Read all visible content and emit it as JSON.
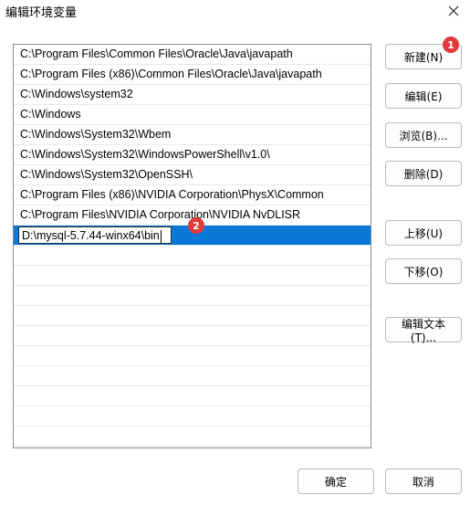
{
  "window": {
    "title": "编辑环境变量"
  },
  "path_entries": [
    "C:\\Program Files\\Common Files\\Oracle\\Java\\javapath",
    "C:\\Program Files (x86)\\Common Files\\Oracle\\Java\\javapath",
    "C:\\Windows\\system32",
    "C:\\Windows",
    "C:\\Windows\\System32\\Wbem",
    "C:\\Windows\\System32\\WindowsPowerShell\\v1.0\\",
    "C:\\Windows\\System32\\OpenSSH\\",
    "C:\\Program Files (x86)\\NVIDIA Corporation\\PhysX\\Common",
    "C:\\Program Files\\NVIDIA Corporation\\NVIDIA NvDLISR"
  ],
  "editing_entry": {
    "value": "D:\\mysql-5.7.44-winx64\\bin"
  },
  "buttons": {
    "new": "新建(N)",
    "edit": "编辑(E)",
    "browse": "浏览(B)...",
    "delete": "删除(D)",
    "move_up": "上移(U)",
    "move_down": "下移(O)",
    "edit_text": "编辑文本(T)...",
    "ok": "确定",
    "cancel": "取消"
  },
  "annotations": {
    "badge1": "1",
    "badge2": "2"
  },
  "colors": {
    "selection": "#0a78d7",
    "badge": "#e03a3a"
  }
}
